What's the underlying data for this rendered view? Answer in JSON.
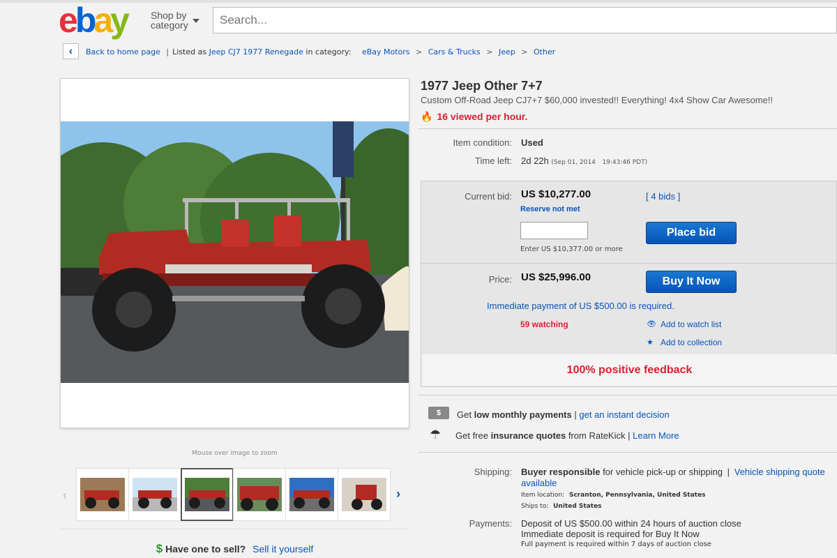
{
  "header": {
    "logo_letters": [
      "e",
      "b",
      "a",
      "y"
    ],
    "logo_colors": [
      "#e53238",
      "#0064d2",
      "#f5af02",
      "#86b817"
    ],
    "shop_by_line1": "Shop by",
    "shop_by_line2": "category",
    "search_placeholder": "Search..."
  },
  "breadcrumb": {
    "back_label": "Back to home page",
    "listed_prefix": "Listed as",
    "listed_item": "Jeep CJ7 1977 Renegade",
    "in_category": "in category:",
    "path": [
      "eBay Motors",
      "Cars & Trucks",
      "Jeep",
      "Other"
    ],
    "separator": ">",
    "bar": "|"
  },
  "gallery": {
    "zoom_hint": "Mouse over image to zoom",
    "thumbnail_count": 6,
    "selected_index": 2
  },
  "sell": {
    "dollar": "$",
    "question": "Have one to sell?",
    "link": "Sell it yourself"
  },
  "item": {
    "title": "1977 Jeep Other 7+7",
    "subtitle": "Custom Off-Road Jeep CJ7+7 $60,000 invested!! Everything! 4x4 Show Car Awesome!!",
    "viewed": "16 viewed per hour.",
    "condition_label": "Item condition:",
    "condition_value": "Used",
    "time_left_label": "Time left:",
    "time_left_value": "2d 22h",
    "time_left_end": "(Sep 01, 2014",
    "time_left_clock": "19:43:46 PDT)"
  },
  "bid": {
    "current_label": "Current bid:",
    "current_value": "US $10,277.00",
    "reserve": "Reserve not met",
    "bids_open": "[",
    "bids_link": "4 bids",
    "bids_close": "]",
    "input_value": "",
    "enter_hint": "Enter US $10,377.00 or more",
    "place_bid": "Place bid",
    "price_label": "Price:",
    "price_value": "US $25,996.00",
    "buy_now": "Buy It Now",
    "immediate": "Immediate payment of US $500.00 is required.",
    "watching": "59 watching",
    "watch_link": "Add to watch list",
    "collection_link": "Add to collection",
    "feedback": "100% positive feedback"
  },
  "financing": {
    "money_icon_text": "$",
    "get1": "Get",
    "low_payments": "low monthly payments",
    "bar": "|",
    "decision_link": "get an instant decision",
    "get2": "Get free",
    "insurance": "insurance quotes",
    "from": "from RateKick",
    "learn_more": "Learn More"
  },
  "shipping": {
    "label": "Shipping:",
    "buyer": "Buyer responsible",
    "rest": "for vehicle pick-up or shipping",
    "bar": "|",
    "quote_link_1": "Vehicle shipping quote",
    "quote_link_2": "available",
    "location_label": "Item location:",
    "location_value": "Scranton, Pennsylvania, United States",
    "ships_label": "Ships to:",
    "ships_value": "United States"
  },
  "payments": {
    "label": "Payments:",
    "line1": "Deposit of US $500.00 within 24 hours of auction close",
    "line2": "Immediate deposit is required for Buy It Now",
    "line3": "Full payment is required within 7 days of auction close"
  }
}
